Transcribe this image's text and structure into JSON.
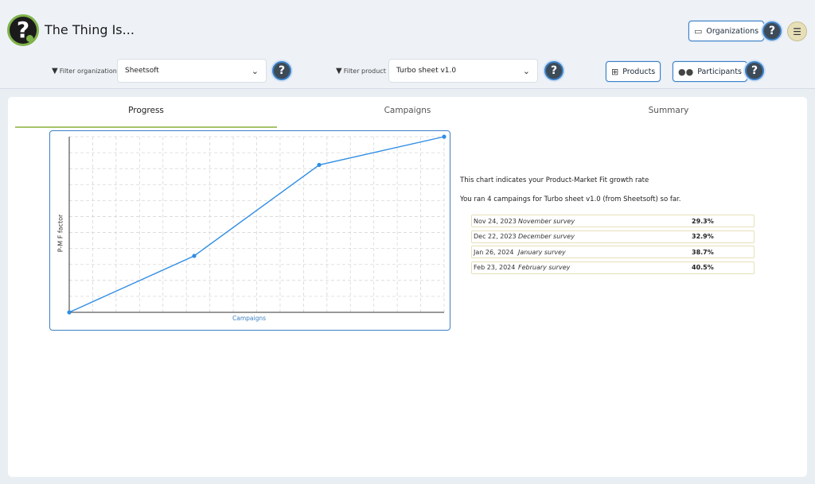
{
  "app": {
    "title": "The Thing Is..."
  },
  "header": {
    "organizations_label": "Organizations",
    "products_label": "Products",
    "participants_label": "Participants",
    "help_glyph": "?"
  },
  "filters": {
    "organization": {
      "label": "Filter organization",
      "value": "Sheetsoft"
    },
    "product": {
      "label": "Filter product",
      "value": "Turbo sheet v1.0"
    }
  },
  "tabs": [
    {
      "label": "Progress",
      "active": true
    },
    {
      "label": "Campaigns",
      "active": false
    },
    {
      "label": "Summary",
      "active": false
    }
  ],
  "chart_data": {
    "type": "line",
    "xlabel": "Campaigns",
    "ylabel": "P-M F factor",
    "categories": [
      "November survey",
      "December survey",
      "January survey",
      "February survey"
    ],
    "values": [
      29.3,
      32.9,
      38.7,
      40.5
    ],
    "grid": true,
    "series_color": "#2f8de4"
  },
  "summary": {
    "line1": "This chart indicates your Product-Market Fit growth rate",
    "line2": "You ran 4 campaings for Turbo sheet v1.0 (from Sheetsoft) so far."
  },
  "campaigns": [
    {
      "date": "Nov 24, 2023",
      "name": "November survey",
      "pct": "29.3%"
    },
    {
      "date": "Dec 22, 2023",
      "name": "December survey",
      "pct": "32.9%"
    },
    {
      "date": "Jan 26, 2024",
      "name": "January survey",
      "pct": "38.7%"
    },
    {
      "date": "Feb 23, 2024",
      "name": "February survey",
      "pct": "40.5%"
    }
  ]
}
